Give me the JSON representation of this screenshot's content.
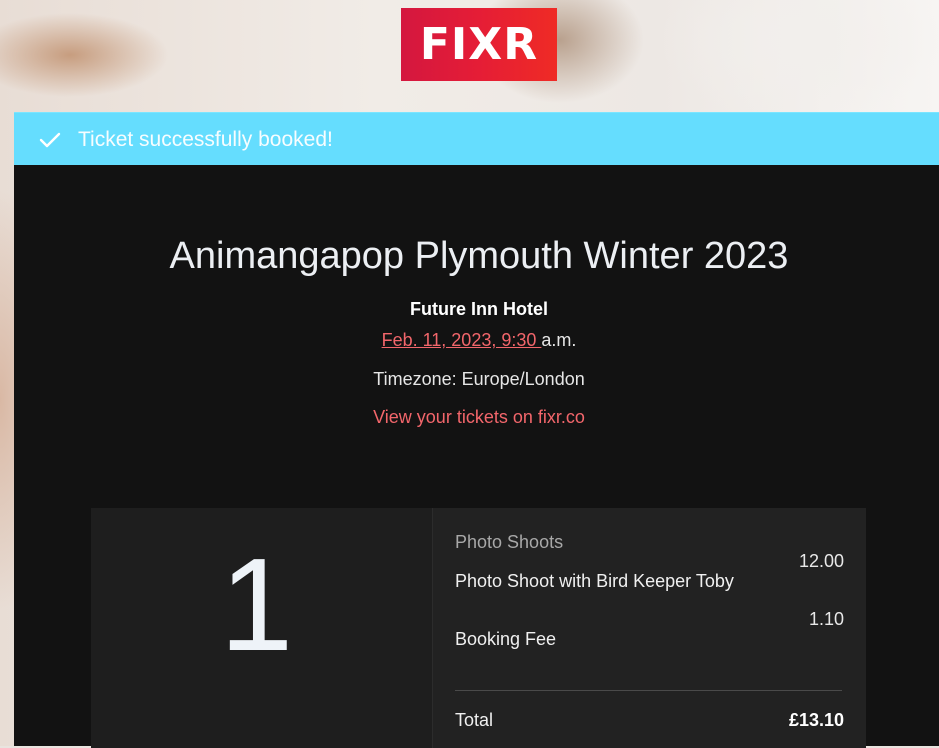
{
  "brand": {
    "logo_text": "FIXR",
    "colors": {
      "logo_red": "#e51d36",
      "banner": "#65ddfe",
      "link": "#f2666b",
      "panel": "#121212"
    }
  },
  "banner": {
    "icon": "check-icon",
    "message": "Ticket successfully booked!"
  },
  "event": {
    "title": "Animangapop Plymouth Winter 2023",
    "venue": "Future Inn Hotel",
    "date_link": "Feb. 11, 2023, 9:30 ",
    "date_suffix": "a.m.",
    "timezone": "Timezone: Europe/London",
    "view_tickets_link": "View your tickets on fixr.co"
  },
  "ticket": {
    "quantity": "1",
    "category": "Photo Shoots",
    "items": [
      {
        "label": "Photo Shoot with Bird Keeper Toby",
        "price": "12.00"
      },
      {
        "label": "Booking Fee",
        "price": "1.10"
      }
    ],
    "total_label": "Total",
    "total_value": "£13.10"
  }
}
